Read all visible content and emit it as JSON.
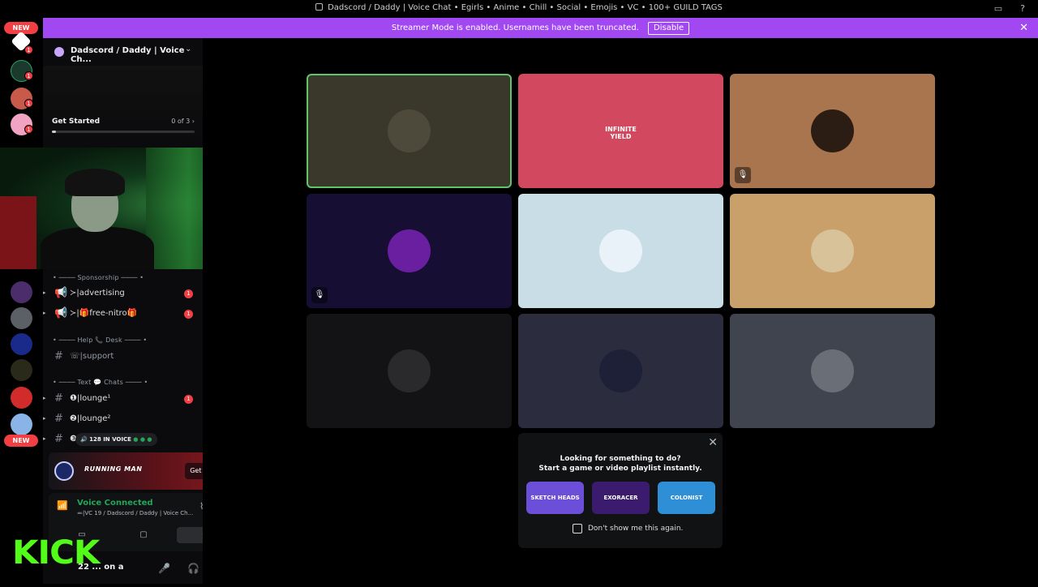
{
  "window": {
    "title": "Dadscord / Daddy | Voice Chat • Egirls • Anime • Chill • Social • Emojis • VC • 100+ GUILD TAGS"
  },
  "banner": {
    "message": "Streamer Mode is enabled. Usernames have been truncated.",
    "disable_label": "Disable"
  },
  "guild_rail": {
    "new_top": "NEW",
    "new_bottom": "NEW",
    "badges": [
      "1",
      "1",
      "1",
      "1"
    ]
  },
  "server": {
    "name": "Dadscord / Daddy | Voice Ch...",
    "get_started_label": "Get Started",
    "get_started_count": "0 of 3",
    "get_started_progress": 0.03
  },
  "categories": [
    {
      "label": "• ──── Sponsorship ──── •"
    },
    {
      "label": "• ──── Help 📞 Desk ──── •"
    },
    {
      "label": "• ──── Text 💬 Chats ──── •"
    }
  ],
  "channels": [
    {
      "name": "≻|advertising",
      "badge": "1"
    },
    {
      "name": "≻|🎁free-nitro🎁",
      "badge": "1"
    },
    {
      "name": "☏|support",
      "badge": ""
    },
    {
      "name": "❶|lounge¹",
      "badge": "1"
    },
    {
      "name": "❷|lounge²",
      "badge": ""
    },
    {
      "name": "❸",
      "badge": ""
    }
  ],
  "in_voice": {
    "count_label": "128 IN VOICE"
  },
  "promo": {
    "logo_text": "RUNNING MAN",
    "reward_label": "Get Reward!"
  },
  "voice": {
    "status": "Voice Connected",
    "channel": "≕|VC 19 / Dadscord / Daddy | Voice Ch..."
  },
  "user": {
    "name_partial": "22 ... on a"
  },
  "overlay": {
    "kick_text": "KICK"
  },
  "tiles": [
    {
      "bg": "#3a382b",
      "avatar_bg": "#4d4a3b",
      "active": true,
      "label": "",
      "mic": ""
    },
    {
      "bg": "#d2495f",
      "avatar_bg": "",
      "active": false,
      "label": "INFINITE\nYIELD",
      "mic": ""
    },
    {
      "bg": "#a8754f",
      "avatar_bg": "#2b1d14",
      "active": false,
      "label": "",
      "mic": "🎙"
    },
    {
      "bg": "#160f33",
      "avatar_bg": "#6a1fa0",
      "active": false,
      "label": "",
      "mic": "🎙"
    },
    {
      "bg": "#c9dde6",
      "avatar_bg": "#e9f2f8",
      "active": false,
      "label": "",
      "mic": ""
    },
    {
      "bg": "#c9a069",
      "avatar_bg": "#d8c29a",
      "active": false,
      "label": "",
      "mic": ""
    },
    {
      "bg": "#131315",
      "avatar_bg": "#2a2a2c",
      "active": false,
      "label": "",
      "mic": ""
    },
    {
      "bg": "#2b2d3f",
      "avatar_bg": "#1d2036",
      "active": false,
      "label": "",
      "mic": ""
    },
    {
      "bg": "#40444f",
      "avatar_bg": "#6a6f77",
      "active": false,
      "label": "",
      "mic": ""
    }
  ],
  "activity": {
    "line1": "Looking for something to do?",
    "line2": "Start a game or video playlist instantly.",
    "cards": [
      {
        "label": "SKETCH HEADS",
        "color": "#6b4fd8"
      },
      {
        "label": "EXORACER",
        "color": "#3a1b6e"
      },
      {
        "label": "COLONIST",
        "color": "#2f8fd6"
      }
    ],
    "checkbox_label": "Don't show me this again."
  },
  "colors": {
    "accent": "#a248f2",
    "voice_green": "#23a55a",
    "badge_red": "#f23f43"
  }
}
